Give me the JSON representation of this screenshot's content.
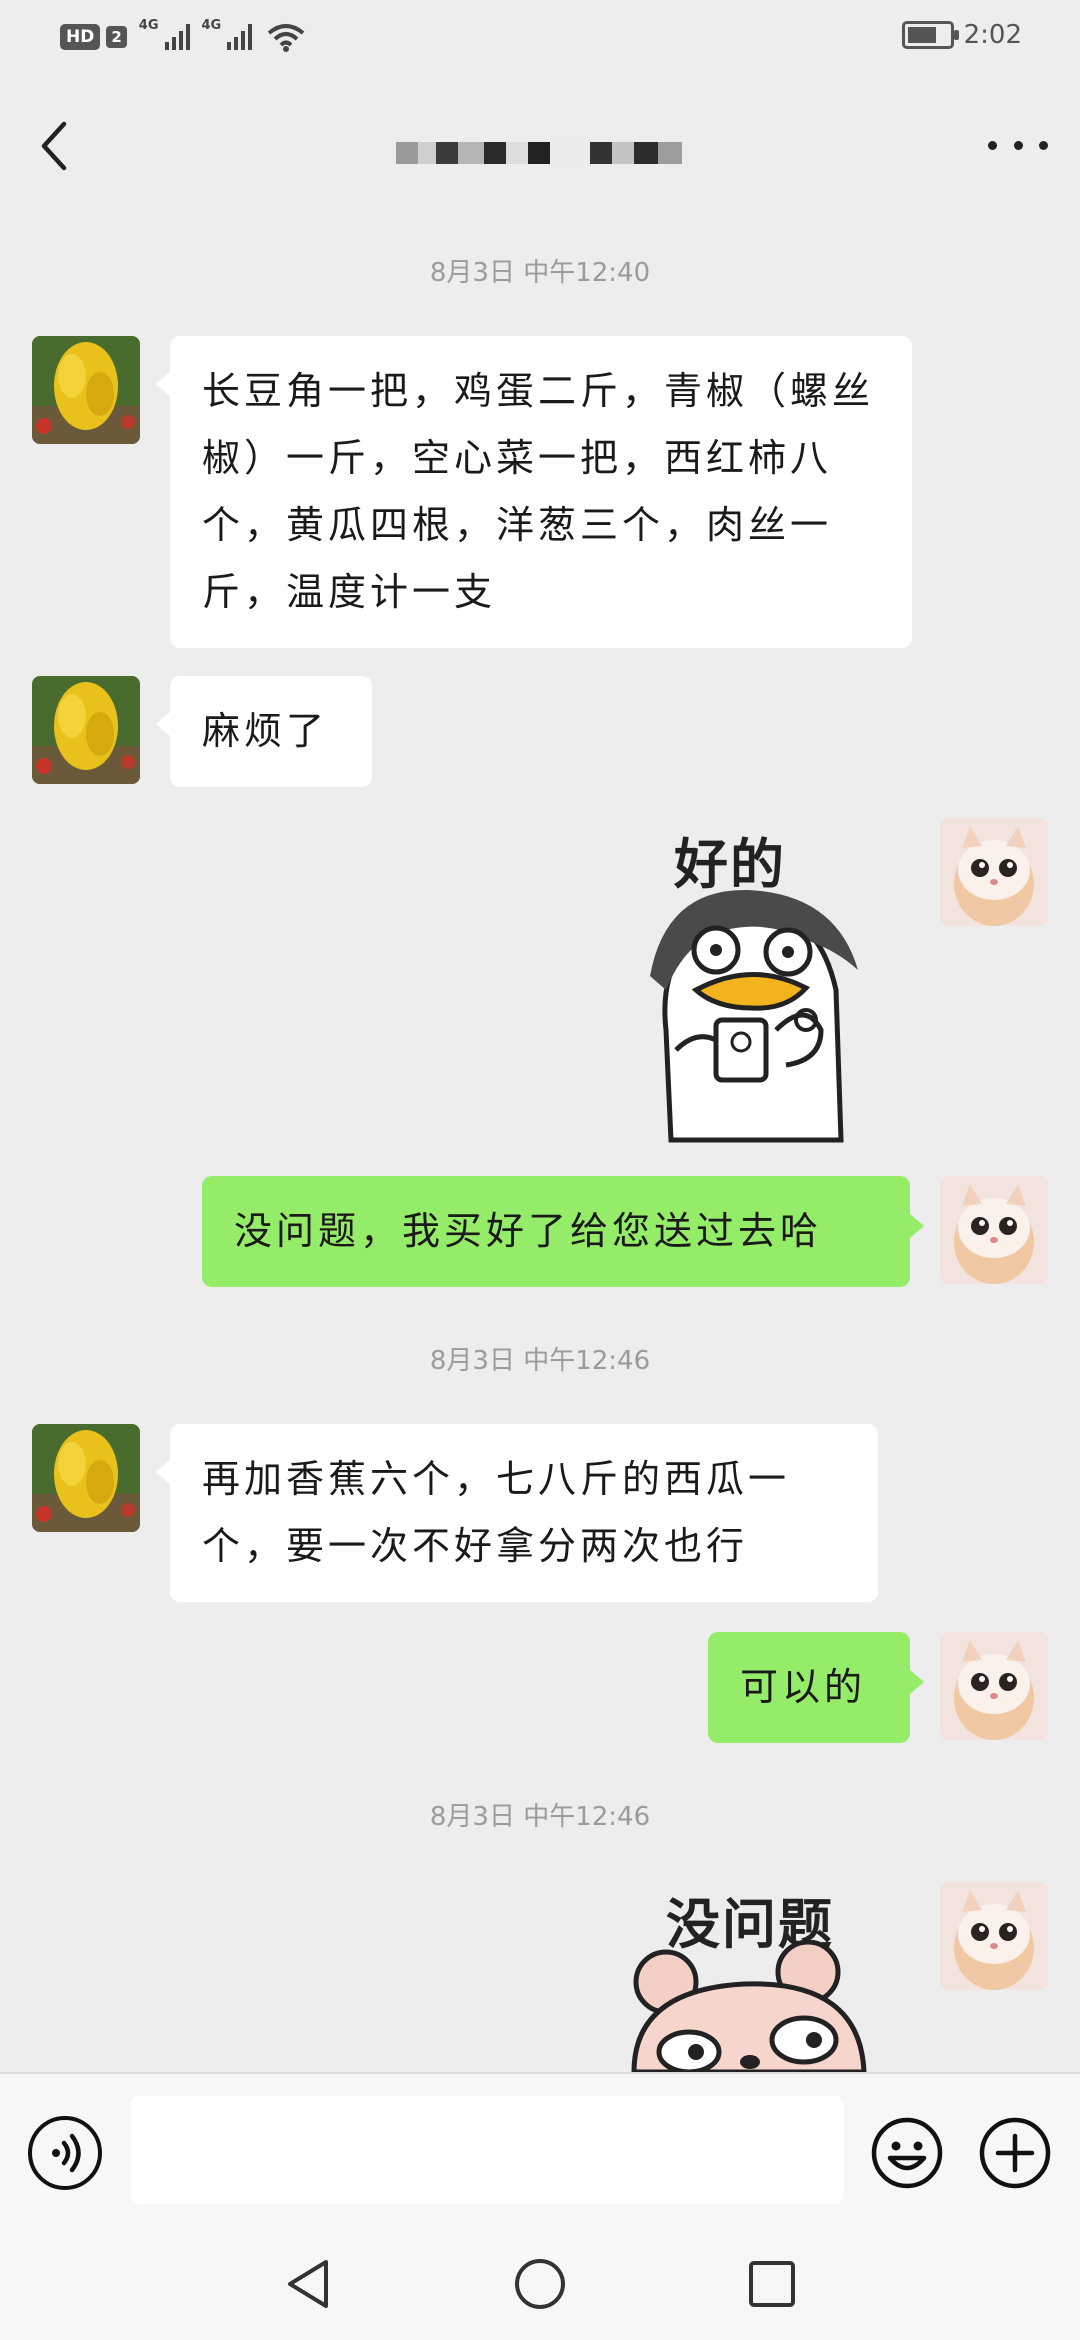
{
  "status_bar": {
    "hd": "HD",
    "sim": "2",
    "network_1": "4G",
    "network_2": "4G",
    "time": "2:02"
  },
  "header": {
    "title": "",
    "icons": {
      "back": "chevron-left-icon",
      "more": "more-dots-icon"
    }
  },
  "messages": [
    {
      "type": "timestamp",
      "text": "8月3日 中午12:40"
    },
    {
      "type": "text",
      "side": "left",
      "text": "长豆角一把，鸡蛋二斤，青椒（螺丝椒）一斤，空心菜一把，西红柿八个，黄瓜四根，洋葱三个，肉丝一斤，温度计一支"
    },
    {
      "type": "text",
      "side": "left",
      "text": "麻烦了"
    },
    {
      "type": "sticker",
      "side": "right",
      "caption": "好的",
      "icon": "duck-sticker"
    },
    {
      "type": "text",
      "side": "right",
      "text": "没问题，我买好了给您送过去哈"
    },
    {
      "type": "timestamp",
      "text": "8月3日 中午12:46"
    },
    {
      "type": "text",
      "side": "left",
      "text": "再加香蕉六个，七八斤的西瓜一个，要一次不好拿分两次也行"
    },
    {
      "type": "text",
      "side": "right",
      "text": "可以的"
    },
    {
      "type": "timestamp",
      "text": "8月3日 中午12:46"
    },
    {
      "type": "sticker",
      "side": "right",
      "caption": "没问题",
      "icon": "bear-sticker"
    }
  ],
  "input_bar": {
    "placeholder": "",
    "icons": {
      "voice": "voice-icon",
      "emoji": "emoji-icon",
      "plus": "plus-icon"
    }
  },
  "nav_bar": {
    "icons": [
      "nav-back-icon",
      "nav-home-icon",
      "nav-recents-icon"
    ]
  },
  "colors": {
    "background": "#ededed",
    "bubble_left": "#ffffff",
    "bubble_right": "#95ec69",
    "timestamp": "#9b9b9b"
  }
}
